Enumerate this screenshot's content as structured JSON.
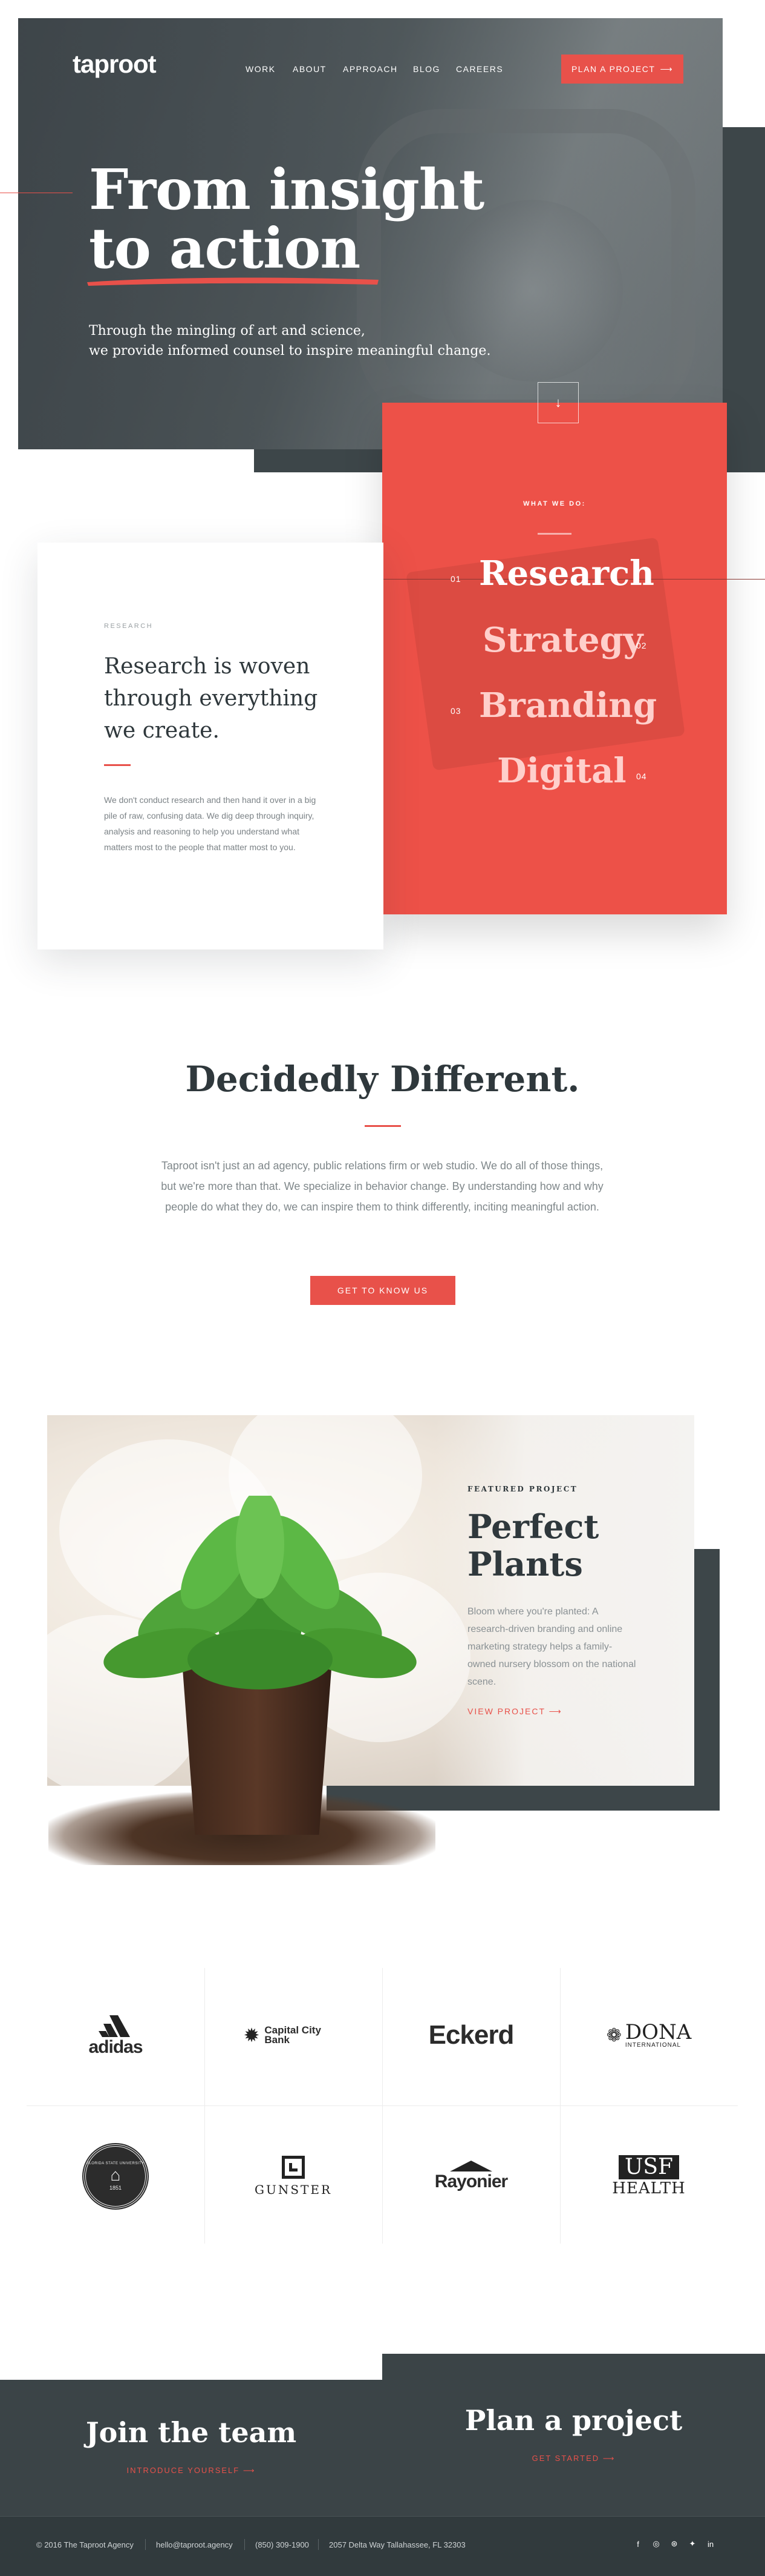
{
  "header": {
    "logo": "taproot",
    "nav": [
      "WORK",
      "ABOUT",
      "APPROACH",
      "BLOG",
      "CAREERS"
    ],
    "cta_label": "PLAN A PROJECT",
    "cta_icon": "arrow-right-icon"
  },
  "hero": {
    "title_line1": "From insight",
    "title_line2": "to action",
    "subtitle_line1": "Through the mingling of art and science,",
    "subtitle_line2": "we provide informed counsel to inspire meaningful change.",
    "scroll_icon": "arrow-down-icon"
  },
  "what_we_do": {
    "label": "WHAT WE DO:",
    "services": [
      {
        "name": "Research",
        "num": "01"
      },
      {
        "name": "Strategy",
        "num": "02"
      },
      {
        "name": "Branding",
        "num": "03"
      },
      {
        "name": "Digital",
        "num": "04"
      }
    ],
    "accent": "#ed5148"
  },
  "research": {
    "label": "RESEARCH",
    "title": "Research is woven through everything we create.",
    "body": "We don't conduct research and then hand it over in a big pile of raw, confusing data. We dig deep through inquiry, analysis and reasoning to help you understand what matters most to the people that matter most to you."
  },
  "different": {
    "title": "Decidedly Different.",
    "body": "Taproot isn't just an ad agency, public relations firm or web studio. We do all of those things, but we're more than that. We specialize in behavior change. By understanding how and why people do what they do, we can inspire them to think differently, inciting meaningful action.",
    "button": "GET TO KNOW US"
  },
  "featured": {
    "label": "FEATURED PROJECT",
    "title_line1": "Perfect",
    "title_line2": "Plants",
    "body": "Bloom where you're planted: A research-driven branding and online marketing strategy helps a family-owned nursery blossom on the national scene.",
    "link": "VIEW PROJECT"
  },
  "clients": {
    "row1": [
      "adidas",
      "Capital City Bank",
      "Eckerd",
      "DONA"
    ],
    "dona_sub": "INTERNATIONAL",
    "seal_text": "FLORIDA STATE UNIVERSITY",
    "seal_year": "1851",
    "gunster": "GUNSTER",
    "rayonier": "Rayonier",
    "usf": "USF",
    "usf_sub": "HEALTH"
  },
  "footer": {
    "join_title": "Join the team",
    "join_link": "INTRODUCE YOURSELF",
    "plan_title": "Plan a project",
    "plan_link": "GET STARTED",
    "copyright": "© 2016 The Taproot Agency",
    "email": "hello@taproot.agency",
    "phone": "(850) 309-1900",
    "address": "2057 Delta Way Tallahassee, FL 32303",
    "social": [
      "facebook-icon",
      "instagram-icon",
      "dribbble-icon",
      "twitter-icon",
      "linkedin-icon"
    ],
    "social_glyphs": [
      "f",
      "◎",
      "⊛",
      "✦",
      "in"
    ]
  }
}
